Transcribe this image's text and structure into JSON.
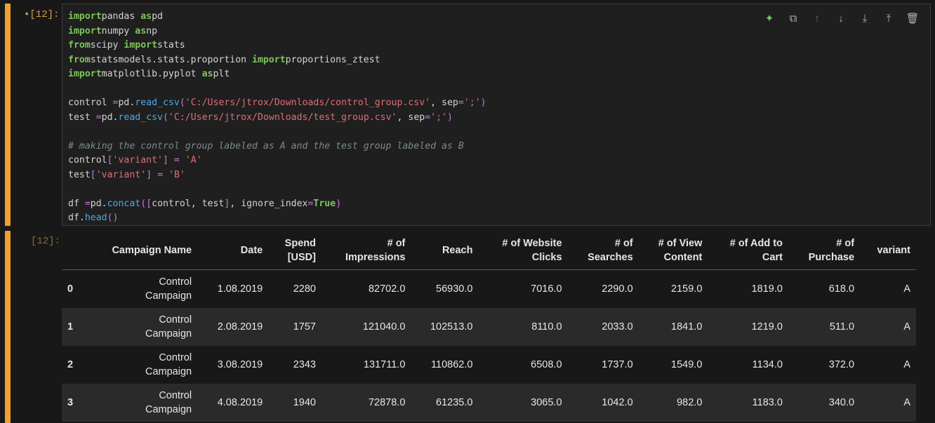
{
  "input_prompt": "•[12]:",
  "output_prompt": "[12]:",
  "code_lines": [
    [
      [
        "kw",
        "import"
      ],
      [
        "",
        "pandas "
      ],
      [
        "kw",
        "as"
      ],
      [
        "",
        "pd"
      ]
    ],
    [
      [
        "kw",
        "import"
      ],
      [
        "",
        "numpy "
      ],
      [
        "kw",
        "as"
      ],
      [
        "",
        "np"
      ]
    ],
    [
      [
        "kw",
        "from"
      ],
      [
        "",
        "scipy "
      ],
      [
        "kw",
        "import"
      ],
      [
        "",
        "stats"
      ]
    ],
    [
      [
        "kw",
        "from"
      ],
      [
        "",
        "statsmodels.stats.proportion "
      ],
      [
        "kw",
        "import"
      ],
      [
        "",
        "proportions_ztest"
      ]
    ],
    [
      [
        "kw",
        "import"
      ],
      [
        "",
        "matplotlib.pyplot "
      ],
      [
        "kw",
        "as"
      ],
      [
        "",
        "plt"
      ]
    ],
    [],
    [
      [
        "",
        "control "
      ],
      [
        "op",
        "="
      ],
      [
        "",
        "pd."
      ],
      [
        "fn",
        "read_csv"
      ],
      [
        "op",
        "("
      ],
      [
        "st",
        "'C:/Users/jtrox/Downloads/control_group.csv'"
      ],
      [
        "",
        ", sep"
      ],
      [
        "op",
        "="
      ],
      [
        "st",
        "';'"
      ],
      [
        "op",
        ")"
      ]
    ],
    [
      [
        "",
        "test "
      ],
      [
        "op",
        "="
      ],
      [
        "",
        "pd."
      ],
      [
        "fn",
        "read_csv"
      ],
      [
        "op",
        "("
      ],
      [
        "st",
        "'C:/Users/jtrox/Downloads/test_group.csv'"
      ],
      [
        "",
        ", sep"
      ],
      [
        "op",
        "="
      ],
      [
        "st",
        "';'"
      ],
      [
        "op",
        ")"
      ]
    ],
    [],
    [
      [
        "cm",
        "# making the control group labeled as A and the test group labeled as B"
      ]
    ],
    [
      [
        "",
        "control"
      ],
      [
        "op",
        "["
      ],
      [
        "st",
        "'variant'"
      ],
      [
        "op",
        "]"
      ],
      [
        "",
        " "
      ],
      [
        "op",
        "="
      ],
      [
        "",
        " "
      ],
      [
        "st",
        "'A'"
      ]
    ],
    [
      [
        "",
        "test"
      ],
      [
        "op",
        "["
      ],
      [
        "st",
        "'variant'"
      ],
      [
        "op",
        "]"
      ],
      [
        "",
        " "
      ],
      [
        "op",
        "="
      ],
      [
        "",
        " "
      ],
      [
        "st",
        "'B'"
      ]
    ],
    [],
    [
      [
        "",
        "df "
      ],
      [
        "op",
        "="
      ],
      [
        "",
        "pd."
      ],
      [
        "fn",
        "concat"
      ],
      [
        "op",
        "(["
      ],
      [
        "",
        "control, test"
      ],
      [
        "op",
        "]"
      ],
      [
        "",
        ", ignore_index"
      ],
      [
        "op",
        "="
      ],
      [
        "bl",
        "True"
      ],
      [
        "op",
        ")"
      ]
    ],
    [
      [
        "",
        "df."
      ],
      [
        "fn",
        "head"
      ],
      [
        "op",
        "()"
      ]
    ]
  ],
  "toolbar": {
    "icons": [
      "sparkle-icon",
      "copy-icon",
      "arrow-up-icon",
      "arrow-down-icon",
      "insert-below-icon",
      "insert-above-icon",
      "trash-icon"
    ],
    "glyphs": [
      "✦",
      "⧉",
      "↑",
      "↓",
      "⤓",
      "⤒",
      "🗑"
    ]
  },
  "table": {
    "headers": [
      "",
      "Campaign Name",
      "Date",
      "Spend [USD]",
      "# of Impressions",
      "Reach",
      "# of Website Clicks",
      "# of Searches",
      "# of View Content",
      "# of Add to Cart",
      "# of Purchase",
      "variant"
    ],
    "header_lines": [
      [
        ""
      ],
      [
        "Campaign Name"
      ],
      [
        "Date"
      ],
      [
        "Spend",
        "[USD]"
      ],
      [
        "# of",
        "Impressions"
      ],
      [
        "Reach"
      ],
      [
        "# of Website",
        "Clicks"
      ],
      [
        "# of",
        "Searches"
      ],
      [
        "# of View",
        "Content"
      ],
      [
        "# of Add to",
        "Cart"
      ],
      [
        "# of",
        "Purchase"
      ],
      [
        "variant"
      ]
    ],
    "rows": [
      [
        "0",
        "Control Campaign",
        "1.08.2019",
        "2280",
        "82702.0",
        "56930.0",
        "7016.0",
        "2290.0",
        "2159.0",
        "1819.0",
        "618.0",
        "A"
      ],
      [
        "1",
        "Control Campaign",
        "2.08.2019",
        "1757",
        "121040.0",
        "102513.0",
        "8110.0",
        "2033.0",
        "1841.0",
        "1219.0",
        "511.0",
        "A"
      ],
      [
        "2",
        "Control Campaign",
        "3.08.2019",
        "2343",
        "131711.0",
        "110862.0",
        "6508.0",
        "1737.0",
        "1549.0",
        "1134.0",
        "372.0",
        "A"
      ],
      [
        "3",
        "Control Campaign",
        "4.08.2019",
        "1940",
        "72878.0",
        "61235.0",
        "3065.0",
        "1042.0",
        "982.0",
        "1183.0",
        "340.0",
        "A"
      ]
    ]
  }
}
